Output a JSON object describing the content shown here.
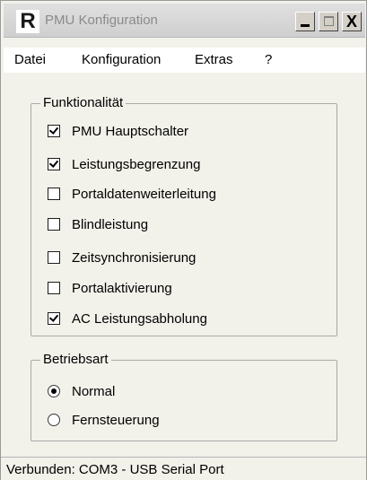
{
  "window": {
    "title": "PMU Konfiguration",
    "logo_letter": "R",
    "minimize_label": "_",
    "close_label": "X"
  },
  "menu": {
    "items": [
      {
        "label": "Datei"
      },
      {
        "label": "Konfiguration"
      },
      {
        "label": "Extras"
      },
      {
        "label": "?"
      }
    ]
  },
  "funktionalitaet": {
    "legend": "Funktionalität",
    "options": [
      {
        "label": "PMU Hauptschalter",
        "checked": true
      },
      {
        "label": "Leistungsbegrenzung",
        "checked": true
      },
      {
        "label": "Portaldatenweiterleitung",
        "checked": false
      },
      {
        "label": "Blindleistung",
        "checked": false
      },
      {
        "label": "Zeitsynchronisierung",
        "checked": false
      },
      {
        "label": "Portalaktivierung",
        "checked": false
      },
      {
        "label": "AC Leistungsabholung",
        "checked": true
      }
    ]
  },
  "betriebsart": {
    "legend": "Betriebsart",
    "options": [
      {
        "label": "Normal",
        "selected": true
      },
      {
        "label": "Fernsteuerung",
        "selected": false
      }
    ]
  },
  "status": {
    "text": "Verbunden: COM3 - USB Serial Port"
  }
}
